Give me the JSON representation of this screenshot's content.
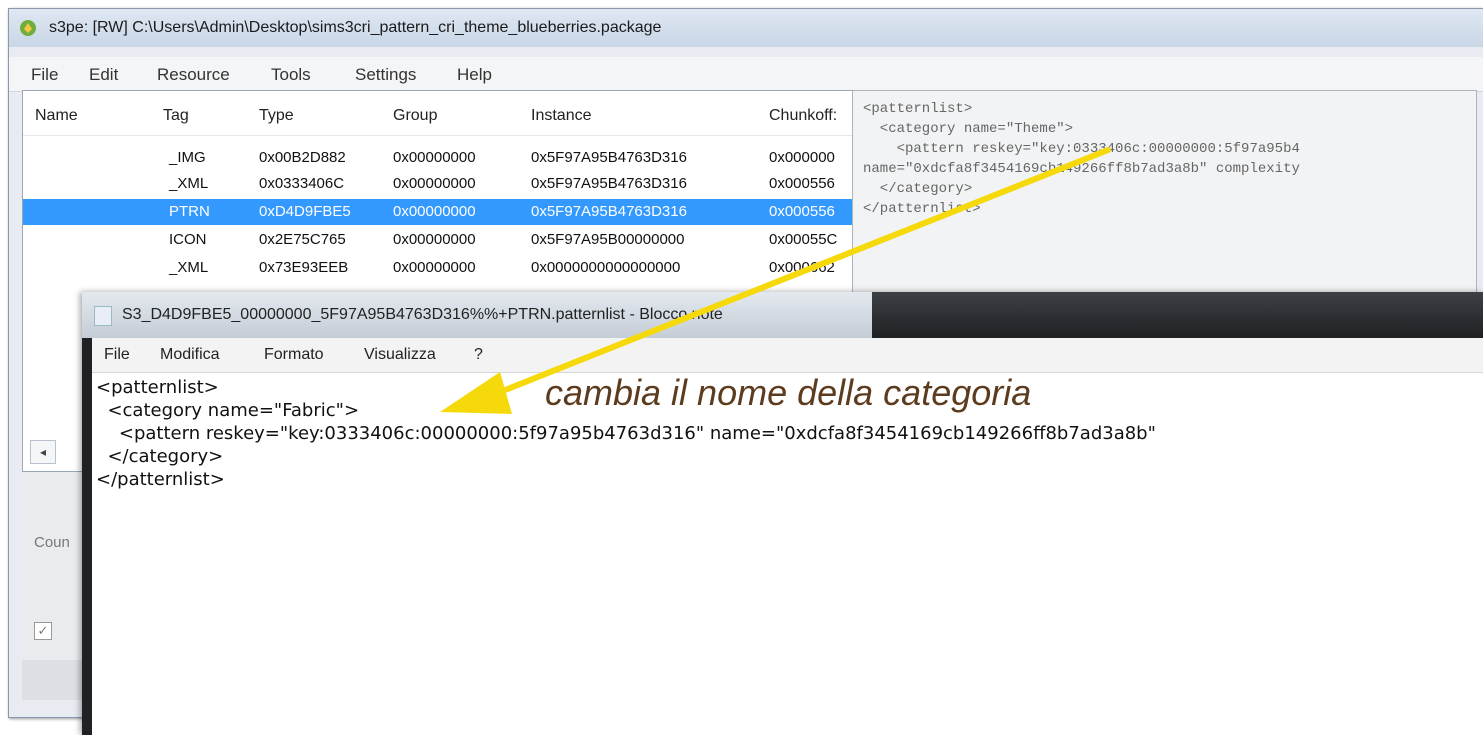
{
  "s3pe": {
    "title": "s3pe: [RW] C:\\Users\\Admin\\Desktop\\sims3cri_pattern_cri_theme_blueberries.package",
    "menu": [
      "File",
      "Edit",
      "Resource",
      "Tools",
      "Settings",
      "Help"
    ],
    "columns": [
      "Name",
      "Tag",
      "Type",
      "Group",
      "Instance",
      "Chunkoff:"
    ],
    "rows": [
      {
        "name": "",
        "tag": "_IMG",
        "type": "0x00B2D882",
        "group": "0x00000000",
        "instance": "0x5F97A95B4763D316",
        "chunk": "0x000000"
      },
      {
        "name": "",
        "tag": "_XML",
        "type": "0x0333406C",
        "group": "0x00000000",
        "instance": "0x5F97A95B4763D316",
        "chunk": "0x000556"
      },
      {
        "name": "",
        "tag": "PTRN",
        "type": "0xD4D9FBE5",
        "group": "0x00000000",
        "instance": "0x5F97A95B4763D316",
        "chunk": "0x000556",
        "selected": true
      },
      {
        "name": "",
        "tag": "ICON",
        "type": "0x2E75C765",
        "group": "0x00000000",
        "instance": "0x5F97A95B00000000",
        "chunk": "0x00055C"
      },
      {
        "name": "",
        "tag": "_XML",
        "type": "0x73E93EEB",
        "group": "0x00000000",
        "instance": "0x0000000000000000",
        "chunk": "0x000662"
      }
    ],
    "preview_text": "<patternlist>\n  <category name=\"Theme\">\n    <pattern reskey=\"key:0333406c:00000000:5f97a95b4\nname=\"0xdcfa8f3454169cb149266ff8b7ad3a8b\" complexity\n  </category>\n</patternlist>",
    "count_label": "Coun",
    "scroll_left_glyph": "◂",
    "checkbox_glyph": "✓"
  },
  "notepad": {
    "title": "S3_D4D9FBE5_00000000_5F97A95B4763D316%%+PTRN.patternlist - Blocco note",
    "menu": [
      "File",
      "Modifica",
      "Formato",
      "Visualizza",
      "?"
    ],
    "content": "<patternlist>\n  <category name=\"Fabric\">\n    <pattern reskey=\"key:0333406c:00000000:5f97a95b4763d316\" name=\"0xdcfa8f3454169cb149266ff8b7ad3a8b\"\n  </category>\n</patternlist>"
  },
  "annotation": {
    "text": "cambia il nome della categoria",
    "arrow_color": "#f5d90a",
    "text_color": "#5c3b1e"
  },
  "colors": {
    "selection": "#3399ff",
    "notepad_titlebar": "#1f2124"
  },
  "icons": [
    "s3pe-app-icon",
    "notepad-file-icon",
    "arrow-annotation"
  ]
}
